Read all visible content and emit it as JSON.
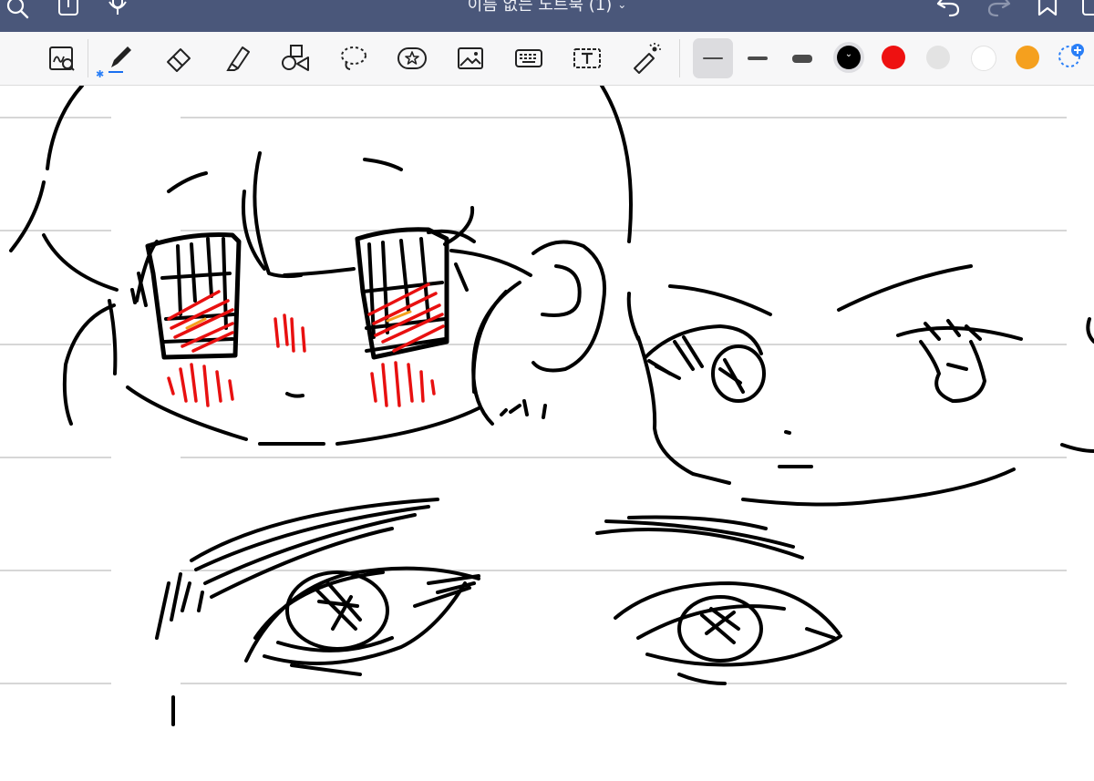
{
  "titlebar": {
    "document_title": "이름 없는 노트북 (1)",
    "icons": [
      "search-icon",
      "share-icon",
      "microphone-icon",
      "undo-icon",
      "redo-icon",
      "bookmark-icon",
      "pages-icon"
    ]
  },
  "toolbar": {
    "tools": [
      "zoom-writing-icon",
      "pen-icon",
      "eraser-icon",
      "highlighter-icon",
      "shapes-icon",
      "lasso-icon",
      "sticker-icon",
      "image-icon",
      "keyboard-icon",
      "text-box-icon",
      "laser-pointer-icon"
    ],
    "selected_tool": "pen",
    "pen_connected_badge": "bluetooth-icon",
    "stroke_sizes": [
      "fine",
      "medium",
      "thick"
    ],
    "selected_stroke": "fine",
    "colors": [
      "#000000",
      "#ee1111",
      "#e3e3e3",
      "#ffffff",
      "#f5a01e"
    ],
    "selected_color": "#000000",
    "add_color_icon": "add-color-icon"
  },
  "canvas": {
    "paper": "ruled",
    "ink_colors": [
      "#000000",
      "#e81010",
      "#f5a01e"
    ]
  }
}
